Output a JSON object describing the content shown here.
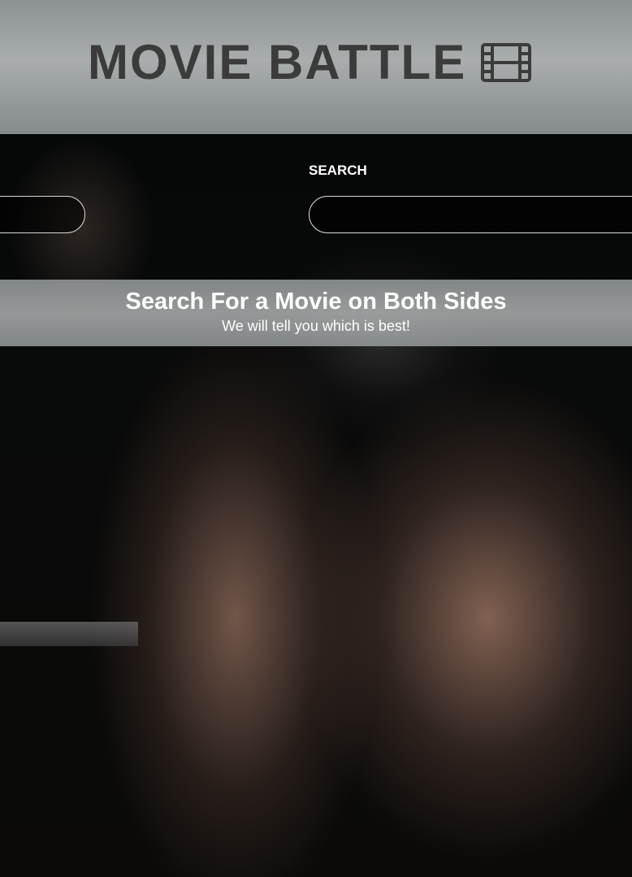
{
  "header": {
    "title": "MOVIE BATTLE",
    "icon": "film-icon",
    "background_color": "#a9adad",
    "text_color": "#3b3b3b"
  },
  "search": {
    "label": "SEARCH",
    "left_value": "",
    "right_value": ""
  },
  "banner": {
    "heading": "Search For a Movie on Both Sides",
    "subheading": "We will tell you which is best!"
  }
}
